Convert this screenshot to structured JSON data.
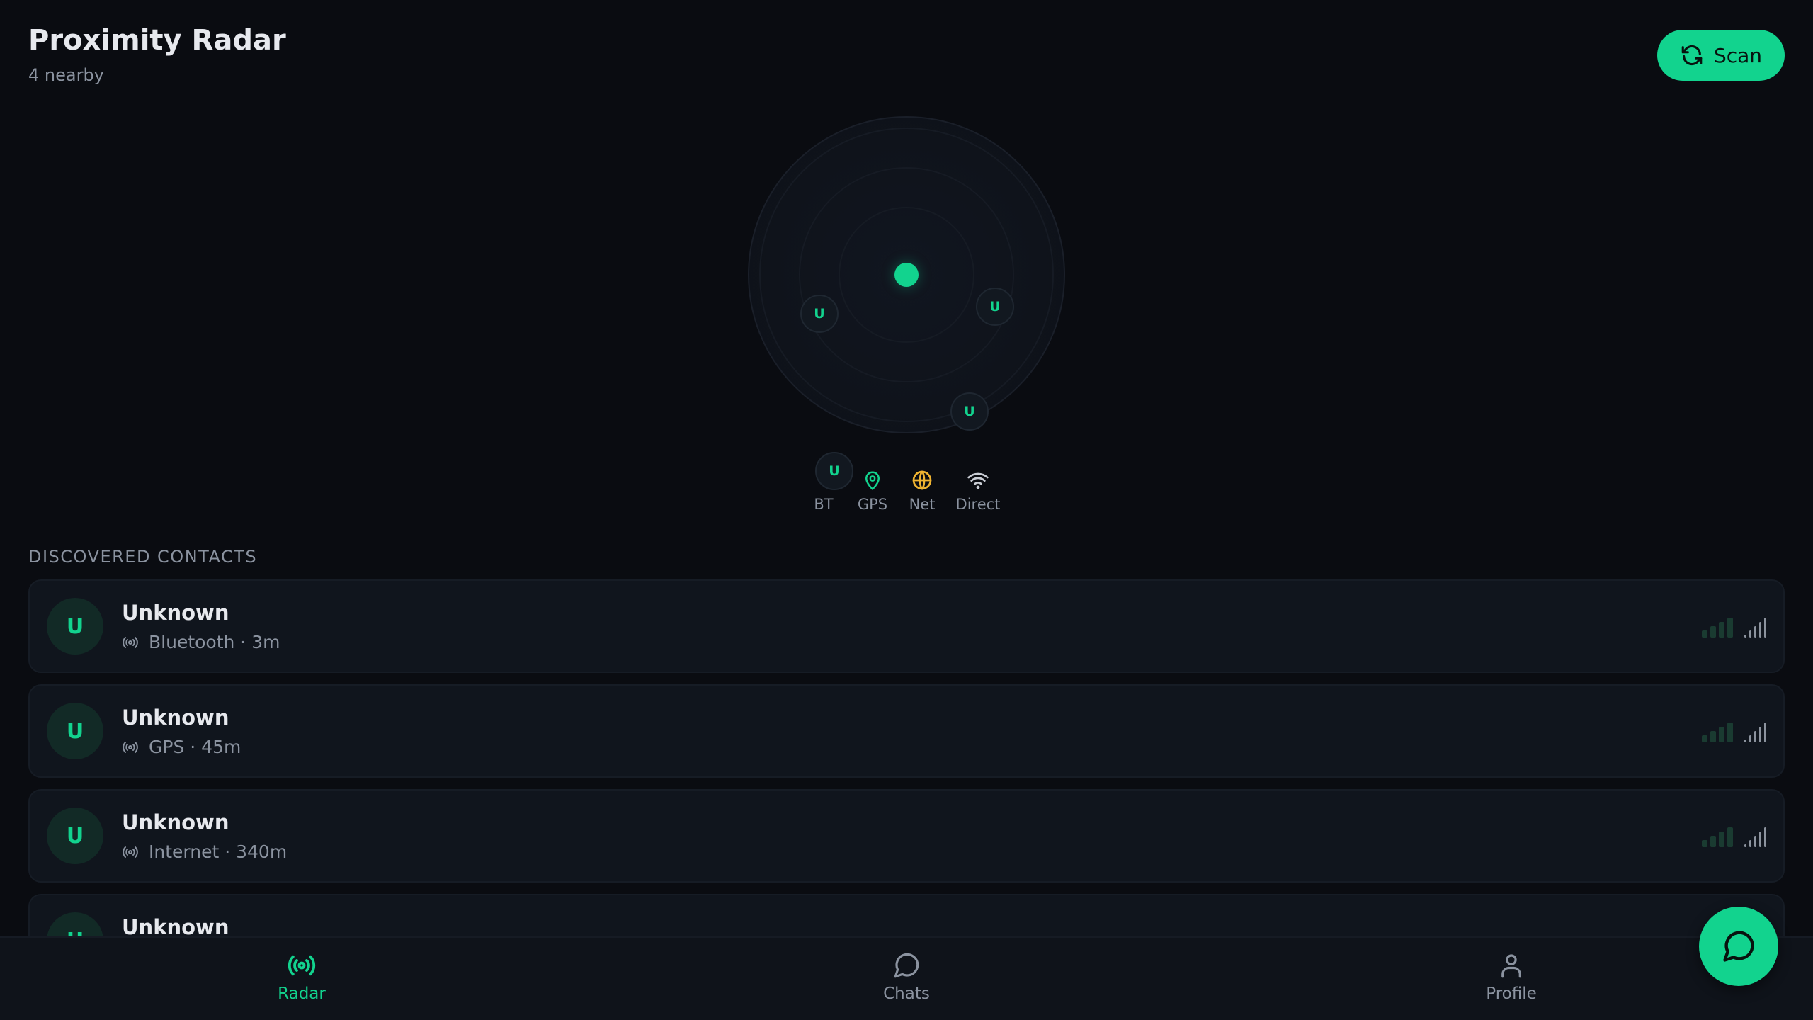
{
  "header": {
    "title": "Proximity Radar",
    "subtitle": "4 nearby",
    "scan_label": "Scan"
  },
  "radar": {
    "peers": [
      {
        "initial": "U"
      },
      {
        "initial": "U"
      },
      {
        "initial": "U"
      },
      {
        "initial": "U"
      }
    ]
  },
  "legend": [
    {
      "label": "BT",
      "icon": "bluetooth-peer-icon"
    },
    {
      "label": "GPS",
      "icon": "map-pin-icon",
      "color": "#12d38e"
    },
    {
      "label": "Net",
      "icon": "globe-icon",
      "color": "#f0b431"
    },
    {
      "label": "Direct",
      "icon": "wifi-icon",
      "color": "#c9cdd4"
    }
  ],
  "section_label": "DISCOVERED CONTACTS",
  "contacts": [
    {
      "initial": "U",
      "name": "Unknown",
      "meta": "Bluetooth · 3m"
    },
    {
      "initial": "U",
      "name": "Unknown",
      "meta": "GPS · 45m"
    },
    {
      "initial": "U",
      "name": "Unknown",
      "meta": "Internet · 340m"
    },
    {
      "initial": "U",
      "name": "Unknown",
      "meta": ""
    }
  ],
  "nav": {
    "radar": "Radar",
    "chats": "Chats",
    "profile": "Profile"
  },
  "colors": {
    "accent": "#12d38e",
    "background": "#0a0c11",
    "card": "#10151d",
    "muted": "#8b93a0"
  }
}
